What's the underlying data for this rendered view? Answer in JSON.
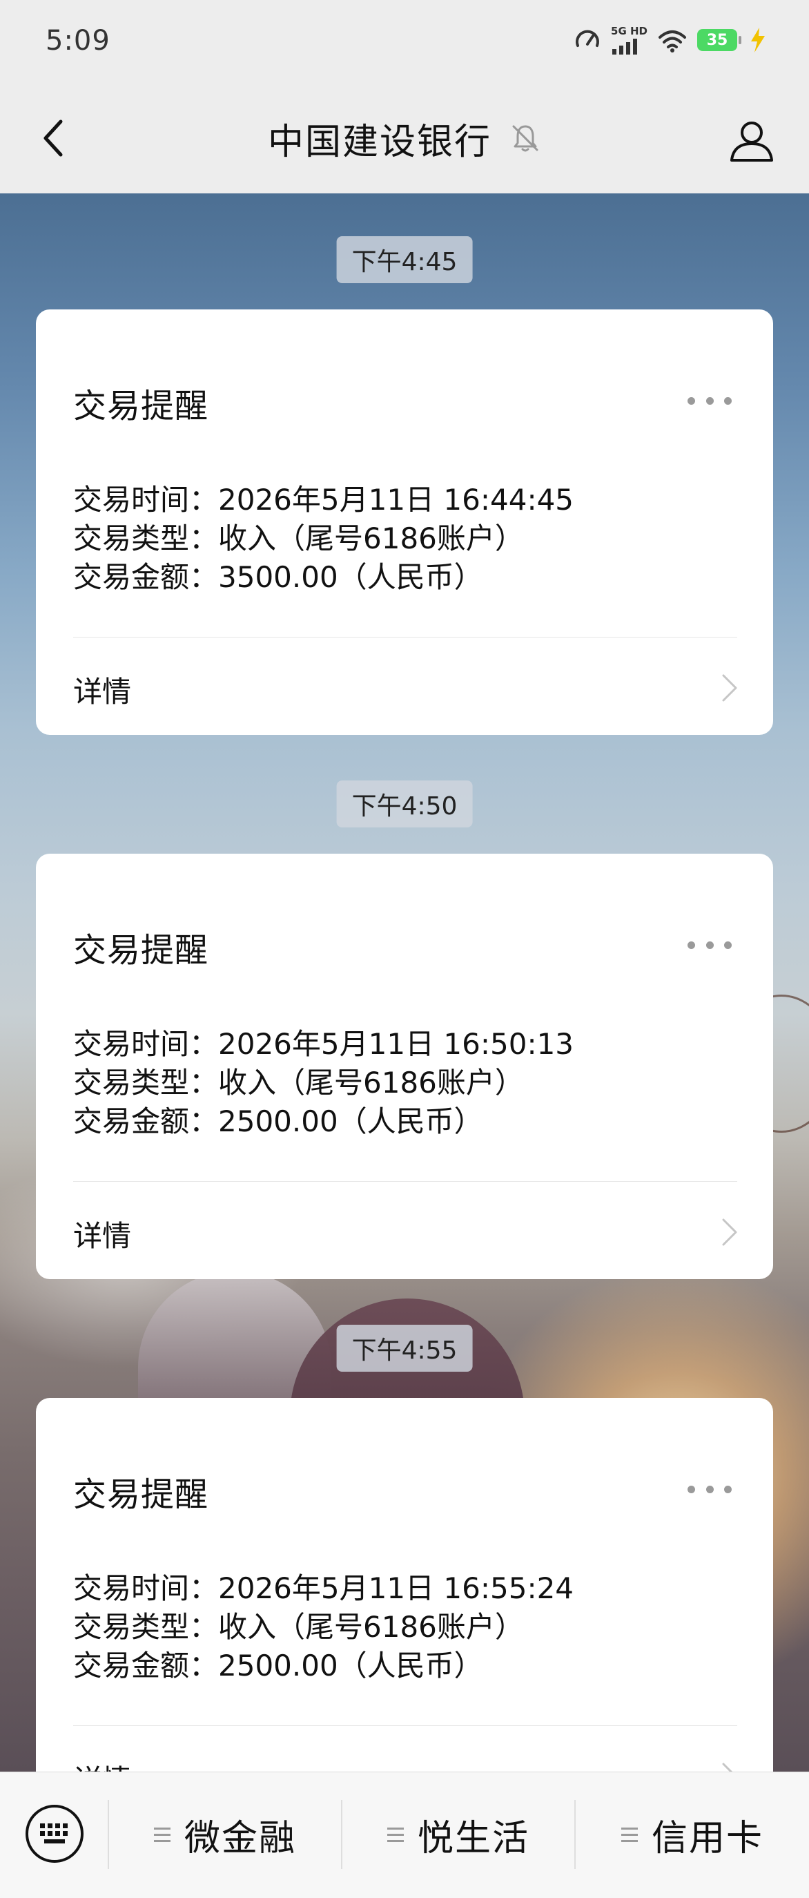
{
  "status_bar": {
    "time": "5:09",
    "network": "5G HD",
    "battery": "35",
    "icons": [
      "speed-meter-icon",
      "signal-icon",
      "wifi-icon",
      "battery-icon",
      "charging-bolt-icon"
    ]
  },
  "header": {
    "title": "中国建设银行",
    "icons": [
      "back-arrow-icon",
      "mute-bell-icon",
      "profile-icon"
    ]
  },
  "messages": [
    {
      "time": "下午4:45",
      "title": "交易提醒",
      "rows": [
        "交易时间：2026年5月11日 16:44:45",
        "交易类型：收入（尾号6186账户）",
        "交易金额：3500.00（人民币）"
      ],
      "detail_label": "详情"
    },
    {
      "time": "下午4:50",
      "title": "交易提醒",
      "rows": [
        "交易时间：2026年5月11日 16:50:13",
        "交易类型：收入（尾号6186账户）",
        "交易金额：2500.00（人民币）"
      ],
      "detail_label": "详情"
    },
    {
      "time": "下午4:55",
      "title": "交易提醒",
      "rows": [
        "交易时间：2026年5月11日 16:55:24",
        "交易类型：收入（尾号6186账户）",
        "交易金额：2500.00（人民币）"
      ],
      "detail_label": "详情"
    }
  ],
  "bottom_menu": {
    "keyboard_icon": "keyboard-icon",
    "items": [
      {
        "label": "微金融"
      },
      {
        "label": "悦生活"
      },
      {
        "label": "信用卡"
      }
    ]
  }
}
